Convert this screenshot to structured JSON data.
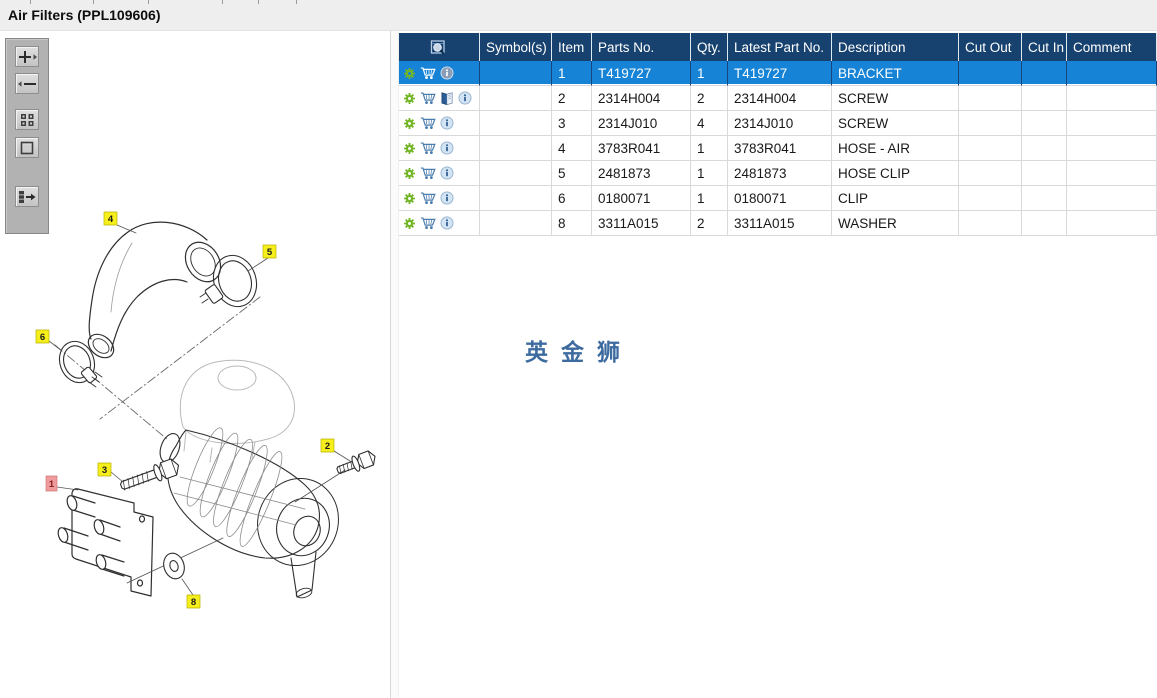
{
  "window": {
    "title": "Air Filters (PPL109606)"
  },
  "colors": {
    "header_bg": "#17426f",
    "selected_row_bg": "#1683d7",
    "selected_grid": "#15477e",
    "grid": "#d9d9d9",
    "topstrip": "#eeeeee",
    "watermark": "#3e6b9f",
    "callout_yellow": "#f6ef1b",
    "callout_red": "#ef9a9c",
    "gear_green": "#72b626",
    "cart_blue": "#4a7dae"
  },
  "toolbar": {
    "buttons": [
      {
        "icon": "zoom-in-icon"
      },
      {
        "icon": "zoom-out-icon"
      },
      {
        "icon": "tile-view-icon"
      },
      {
        "icon": "fit-view-icon"
      },
      {
        "icon": "toggle-panel-icon"
      }
    ]
  },
  "watermark": "英金狮",
  "diagram": {
    "callouts": [
      {
        "label": "4",
        "highlighted": false
      },
      {
        "label": "5",
        "highlighted": false
      },
      {
        "label": "6",
        "highlighted": false
      },
      {
        "label": "2",
        "highlighted": false
      },
      {
        "label": "3",
        "highlighted": false
      },
      {
        "label": "1",
        "highlighted": true
      },
      {
        "label": "8",
        "highlighted": false
      }
    ]
  },
  "table": {
    "header_icon": "preview-search-icon",
    "columns": [
      {
        "label": ""
      },
      {
        "label": "Symbol(s)"
      },
      {
        "label": "Item"
      },
      {
        "label": "Parts No."
      },
      {
        "label": "Qty."
      },
      {
        "label": "Latest Part No."
      },
      {
        "label": "Description"
      },
      {
        "label": "Cut Out"
      },
      {
        "label": "Cut In"
      },
      {
        "label": "Comment"
      }
    ],
    "rows": [
      {
        "selected": true,
        "icons": [
          "gear",
          "cart",
          "info"
        ],
        "symbols": "",
        "item": "1",
        "parts_no": "T419727",
        "qty": "1",
        "latest_part_no": "T419727",
        "description": "BRACKET",
        "cut_out": "",
        "cut_in": "",
        "comment": ""
      },
      {
        "selected": false,
        "icons": [
          "gear",
          "cart",
          "book",
          "info"
        ],
        "symbols": "",
        "item": "2",
        "parts_no": "2314H004",
        "qty": "2",
        "latest_part_no": "2314H004",
        "description": "SCREW",
        "cut_out": "",
        "cut_in": "",
        "comment": ""
      },
      {
        "selected": false,
        "icons": [
          "gear",
          "cart",
          "info"
        ],
        "symbols": "",
        "item": "3",
        "parts_no": "2314J010",
        "qty": "4",
        "latest_part_no": "2314J010",
        "description": "SCREW",
        "cut_out": "",
        "cut_in": "",
        "comment": ""
      },
      {
        "selected": false,
        "icons": [
          "gear",
          "cart",
          "info"
        ],
        "symbols": "",
        "item": "4",
        "parts_no": "3783R041",
        "qty": "1",
        "latest_part_no": "3783R041",
        "description": "HOSE - AIR",
        "cut_out": "",
        "cut_in": "",
        "comment": ""
      },
      {
        "selected": false,
        "icons": [
          "gear",
          "cart",
          "info"
        ],
        "symbols": "",
        "item": "5",
        "parts_no": "2481873",
        "qty": "1",
        "latest_part_no": "2481873",
        "description": "HOSE CLIP",
        "cut_out": "",
        "cut_in": "",
        "comment": ""
      },
      {
        "selected": false,
        "icons": [
          "gear",
          "cart",
          "info"
        ],
        "symbols": "",
        "item": "6",
        "parts_no": "0180071",
        "qty": "1",
        "latest_part_no": "0180071",
        "description": "CLIP",
        "cut_out": "",
        "cut_in": "",
        "comment": ""
      },
      {
        "selected": false,
        "icons": [
          "gear",
          "cart",
          "info"
        ],
        "symbols": "",
        "item": "8",
        "parts_no": "3311A015",
        "qty": "2",
        "latest_part_no": "3311A015",
        "description": "WASHER",
        "cut_out": "",
        "cut_in": "",
        "comment": ""
      }
    ]
  }
}
